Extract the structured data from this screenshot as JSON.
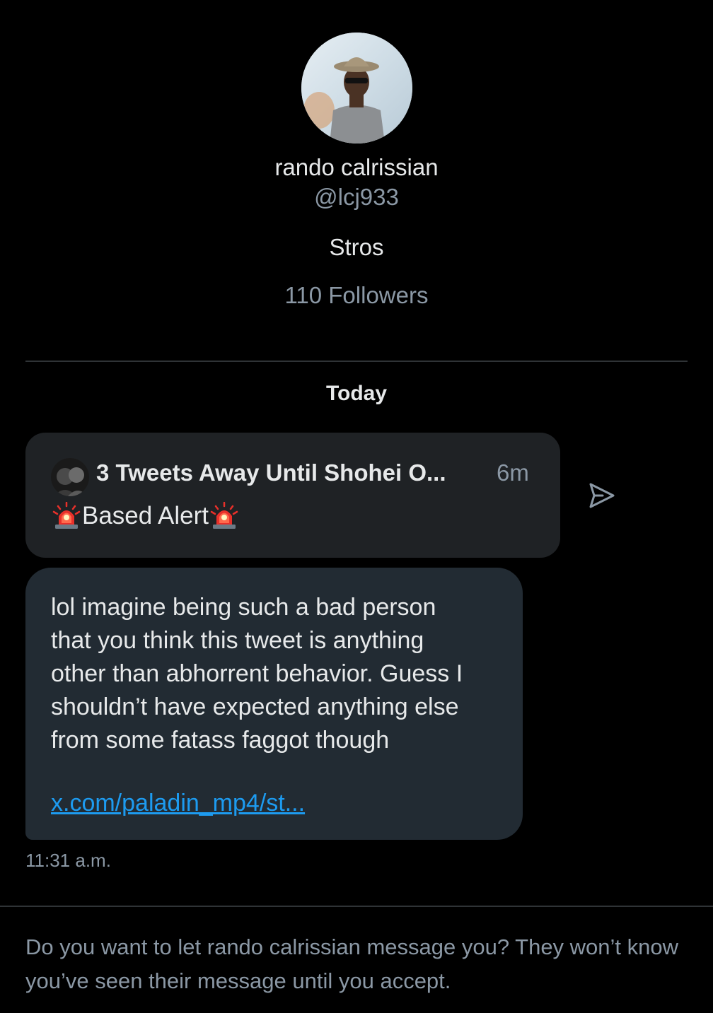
{
  "profile": {
    "display_name": "rando calrissian",
    "handle": "@lcj933",
    "bio": "Stros",
    "followers": "110 Followers"
  },
  "conversation": {
    "date_label": "Today",
    "shared_tweet": {
      "title": "3 Tweets Away Until Shohei O...",
      "time": "6m",
      "body_text": "Based Alert",
      "icon": "police-light-emoji"
    },
    "share_icon": "send-icon",
    "message": {
      "text": "lol imagine being such a bad person\nthat you think this tweet is anything\nother than abhorrent behavior. Guess I\nshouldn’t have expected anything else\nfrom some fatass faggot though",
      "link": "x.com/paladin_mp4/st...",
      "timestamp": "11:31 a.m."
    }
  },
  "request_notice": "Do you want to let rando calrissian message you? They won’t know you’ve seen their message until you accept.",
  "colors": {
    "background": "#000000",
    "card": "#1f2225",
    "bubble": "#222b33",
    "muted": "#8b98a5",
    "link": "#1d9bf0"
  }
}
